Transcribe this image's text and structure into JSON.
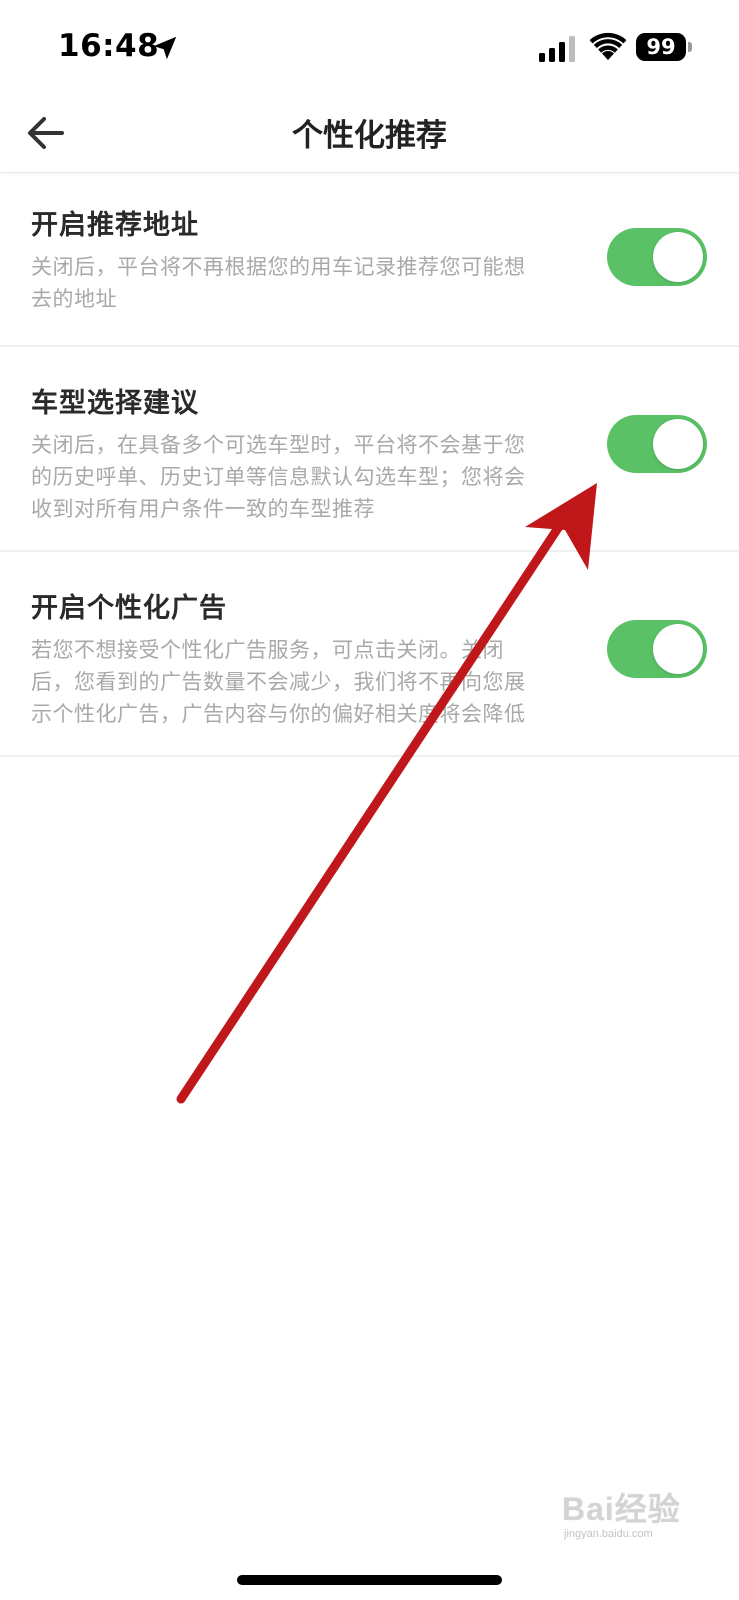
{
  "status_bar": {
    "time": "16:48",
    "battery": "99",
    "icons": [
      "location-arrow-icon",
      "cellular-signal-icon",
      "wifi-icon",
      "battery-icon"
    ]
  },
  "nav": {
    "title": "个性化推荐",
    "back_icon": "back-arrow-icon"
  },
  "settings": [
    {
      "title": "开启推荐地址",
      "desc_lines": [
        "关闭后，平台将不再根据您的用车记录推荐您可能想",
        "去的地址"
      ],
      "enabled": true
    },
    {
      "title": "车型选择建议",
      "desc_lines": [
        "关闭后，在具备多个可选车型时，平台将不会基于您",
        "的历史呼单、历史订单等信息默认勾选车型；您将会",
        "收到对所有用户条件一致的车型推荐"
      ],
      "enabled": true
    },
    {
      "title": "开启个性化广告",
      "desc_lines": [
        "若您不想接受个性化广告服务，可点击关闭。关闭",
        "后，您看到的广告数量不会减少，我们将不再向您展",
        "示个性化广告，广告内容与你的偏好相关度将会降低"
      ],
      "enabled": true
    }
  ],
  "colors": {
    "toggle_on": "#5ac166",
    "annotation_arrow": "#c0171b",
    "title_text": "#2a2a2a",
    "desc_text": "#a9a9a9"
  },
  "watermark": {
    "text": "Bai经验",
    "sub": "jingyan.baidu.com"
  }
}
